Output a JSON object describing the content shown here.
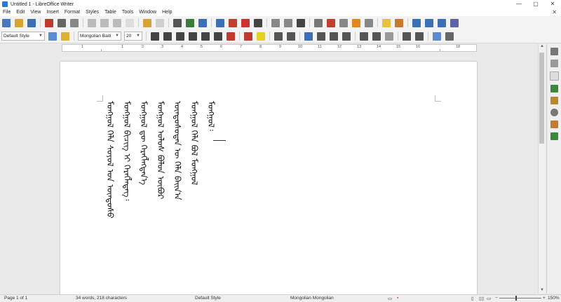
{
  "window": {
    "title": "Untitled 1 - LibreOffice Writer",
    "minimize": "—",
    "maximize": "▢",
    "close": "✕"
  },
  "menu": [
    "File",
    "Edit",
    "View",
    "Insert",
    "Format",
    "Styles",
    "Table",
    "Tools",
    "Window",
    "Help"
  ],
  "menu_close": "✕",
  "toolbar2": {
    "paragraph_style": "Default Style",
    "font_name": "Mongolian Baiti",
    "font_size": "20"
  },
  "ruler": [
    "1",
    "1",
    "2",
    "3",
    "4",
    "5",
    "6",
    "7",
    "8",
    "9",
    "10",
    "11",
    "12",
    "13",
    "14",
    "15",
    "16",
    "18"
  ],
  "document": {
    "lines": [
      "ᠮᠣᠩᠭᠣᠯ᠄",
      "ᠮᠣᠩᠭᠣᠯ ᠬᠡᠯᠡ ᠪᠣᠯ ᠮᠣᠩᠭᠣᠯ",
      "ᠦᠨᠳᠦᠰᠦᠲᠡᠨ ᠦ ᠬᠡᠯᠡ ᠪᠠᠢᠨ᠎ᠠ",
      "ᠮᠣᠩᠭᠣᠯ ᠤᠯᠤᠰ ᠪᠣᠯᠣᠨ ᠥᠪᠥᠷ",
      "ᠮᠣᠩᠭᠣᠯ ᠳᠦ ᠬᠡᠷᠡᠭᠯᠡᠭᠳᠡᠨ᠎ᠡ",
      "ᠮᠣᠩᠭᠣᠯ ᠪᠢᠴᠢᠭ ᠢ ᠬᠡᠷᠡᠭᠯᠡᠳᠡᠭ᠄",
      "ᠮᠣᠩᠭᠣᠯ ᠬᠡᠯᠡ ᠰᠣᠶᠣᠯ ᠤᠨ ᠦᠨᠳᠦᠰᠦ"
    ]
  },
  "status": {
    "page": "Page 1 of 1",
    "words": "34 words, 218 characters",
    "style": "Default Style",
    "language": "Mongolian Mongolian",
    "zoom": "150%"
  },
  "colors": {
    "accent": "#2a7ad5",
    "toolbar": "#f3f3f3"
  }
}
